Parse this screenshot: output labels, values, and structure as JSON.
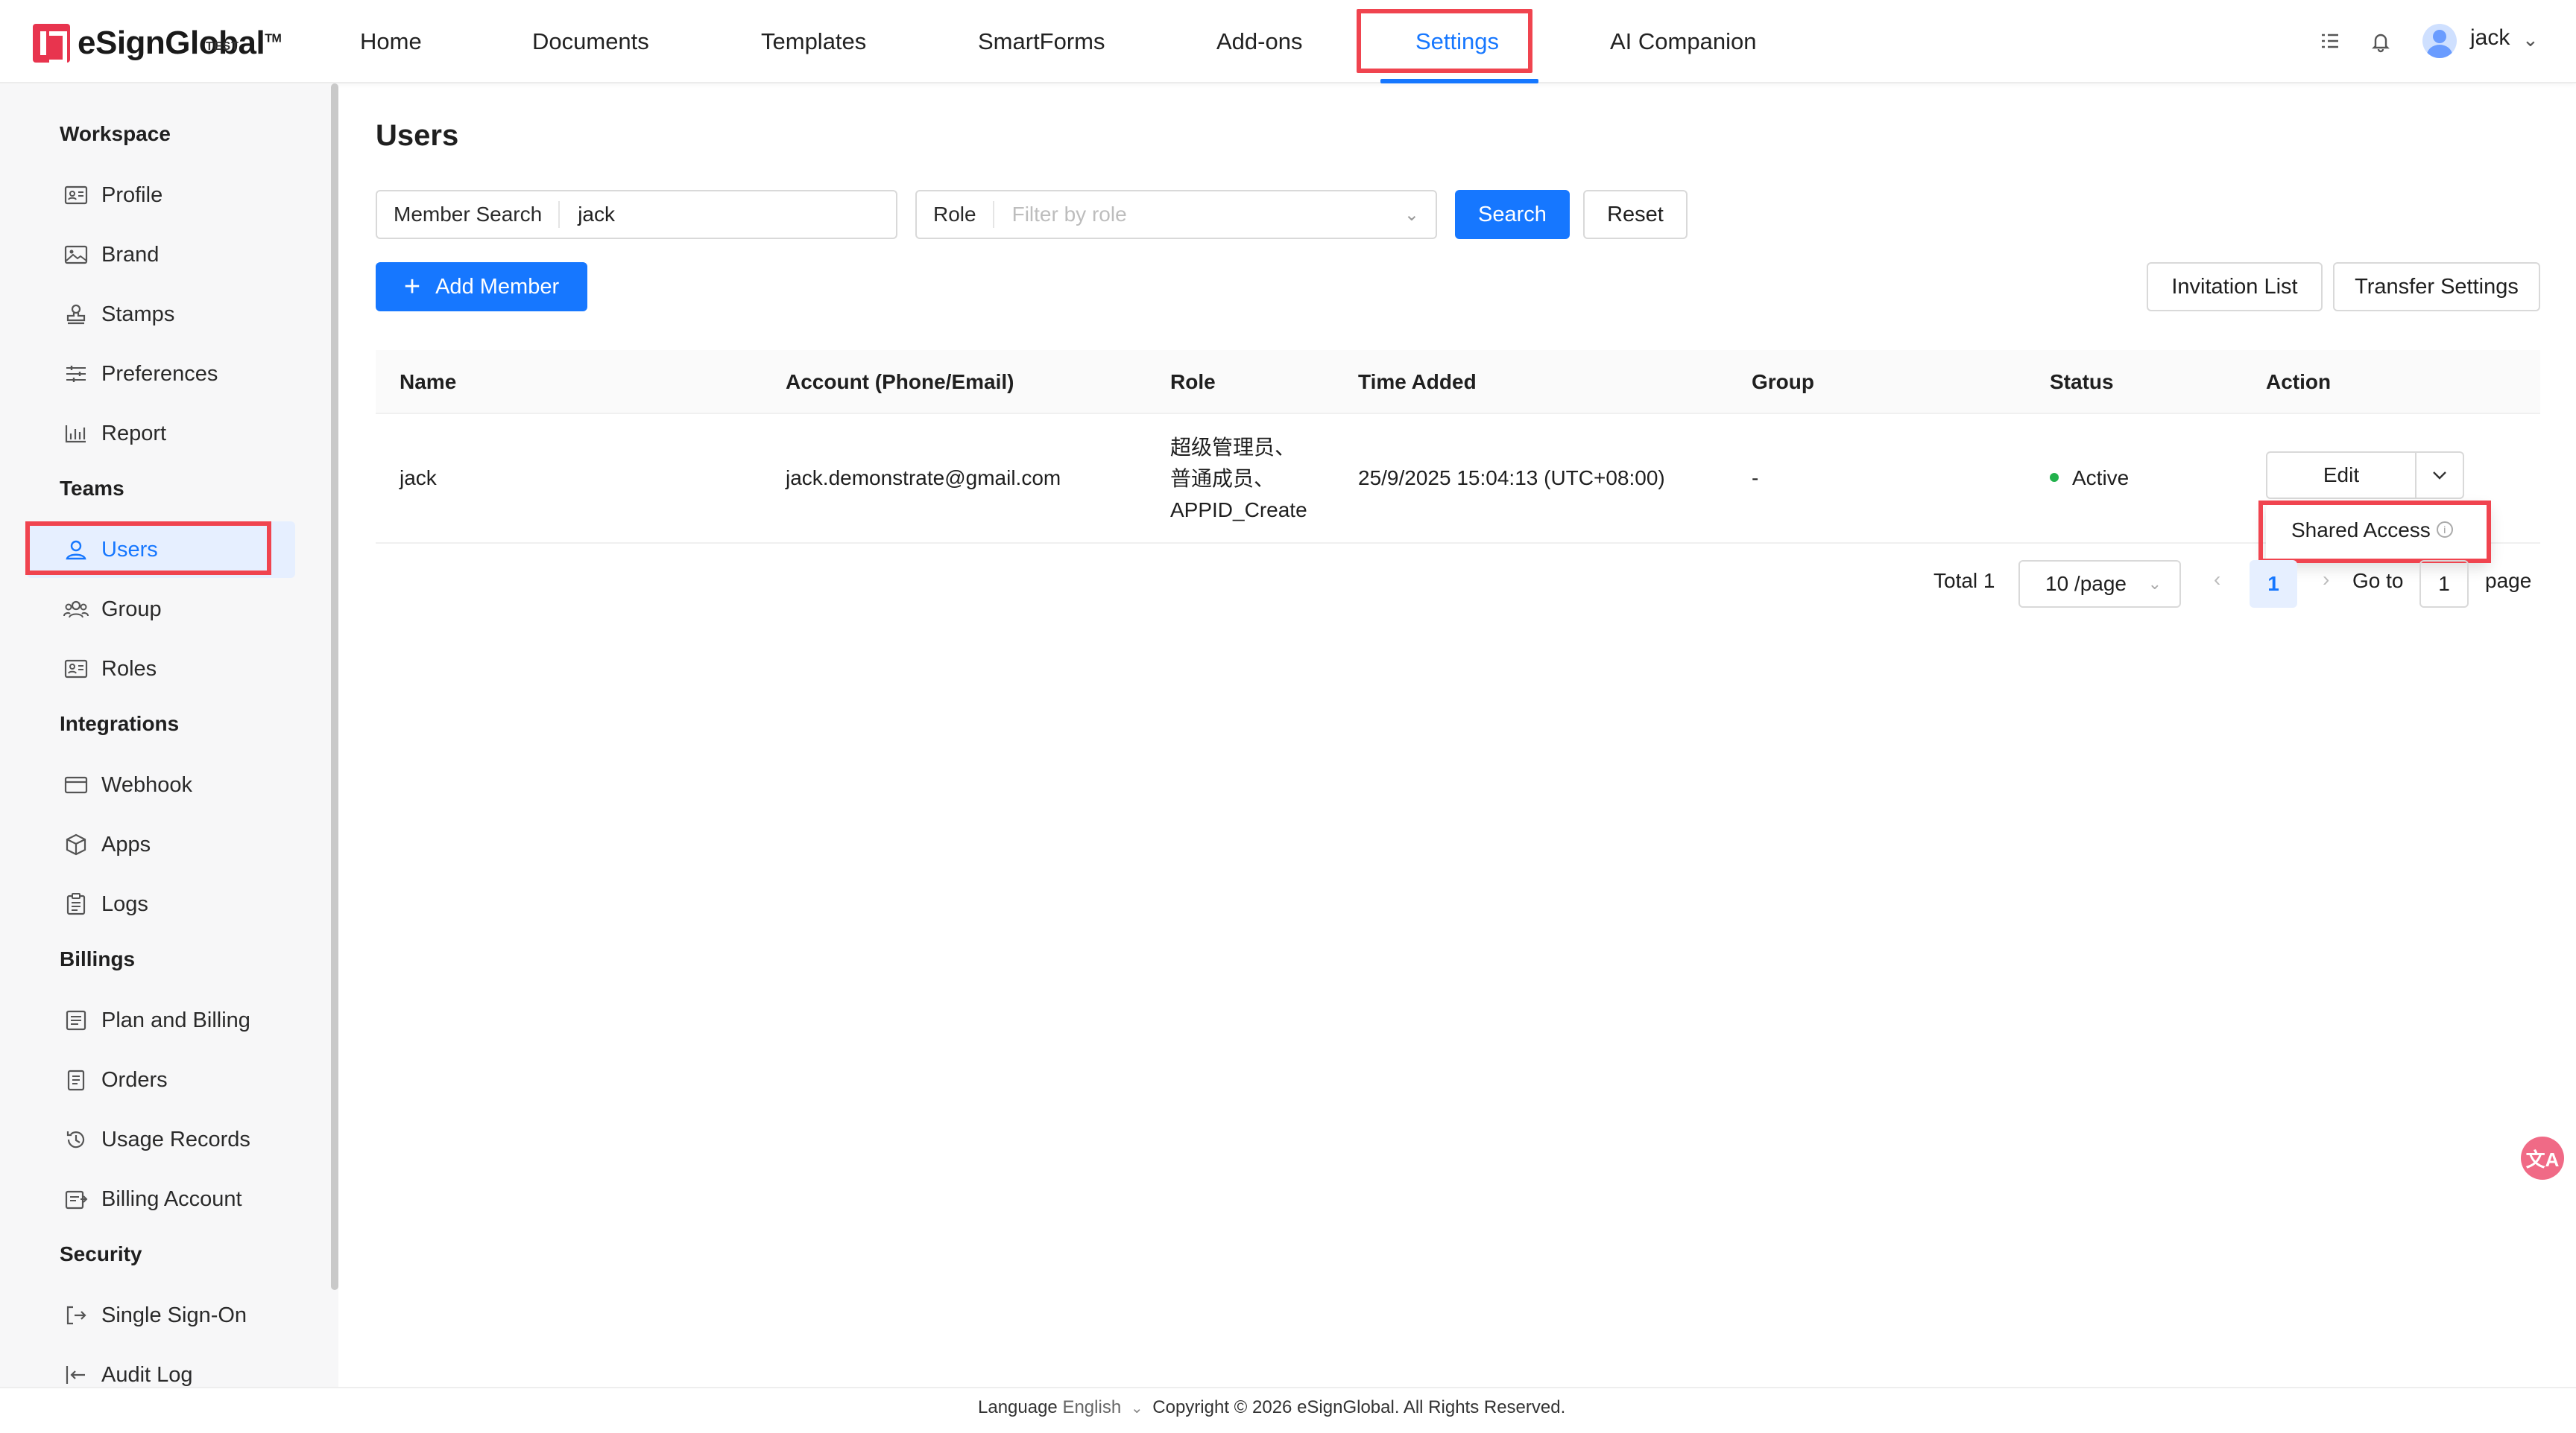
{
  "brand": {
    "name": "eSignGlobal",
    "tm": "TM",
    "env": "TEST"
  },
  "nav": {
    "items": [
      {
        "label": "Home"
      },
      {
        "label": "Documents"
      },
      {
        "label": "Templates"
      },
      {
        "label": "SmartForms"
      },
      {
        "label": "Add-ons"
      },
      {
        "label": "Settings",
        "active": true
      },
      {
        "label": "AI Companion"
      }
    ],
    "user": "jack"
  },
  "sidebar": {
    "sections": [
      {
        "title": "Workspace",
        "items": [
          {
            "label": "Profile",
            "icon": "id-card-icon"
          },
          {
            "label": "Brand",
            "icon": "image-icon"
          },
          {
            "label": "Stamps",
            "icon": "stamp-icon"
          },
          {
            "label": "Preferences",
            "icon": "sliders-icon"
          },
          {
            "label": "Report",
            "icon": "bar-chart-icon"
          }
        ]
      },
      {
        "title": "Teams",
        "items": [
          {
            "label": "Users",
            "icon": "user-icon",
            "active": true
          },
          {
            "label": "Group",
            "icon": "group-icon"
          },
          {
            "label": "Roles",
            "icon": "roles-icon"
          }
        ]
      },
      {
        "title": "Integrations",
        "items": [
          {
            "label": "Webhook",
            "icon": "webhook-icon"
          },
          {
            "label": "Apps",
            "icon": "cube-icon"
          },
          {
            "label": "Logs",
            "icon": "clipboard-icon"
          }
        ]
      },
      {
        "title": "Billings",
        "items": [
          {
            "label": "Plan and Billing",
            "icon": "plan-icon"
          },
          {
            "label": "Orders",
            "icon": "orders-icon"
          },
          {
            "label": "Usage Records",
            "icon": "history-icon"
          },
          {
            "label": "Billing Account",
            "icon": "billing-account-icon"
          }
        ]
      },
      {
        "title": "Security",
        "items": [
          {
            "label": "Single Sign-On",
            "icon": "sso-icon"
          },
          {
            "label": "Audit Log",
            "icon": "audit-log-icon"
          }
        ]
      }
    ]
  },
  "main": {
    "title": "Users",
    "filters": {
      "member_search_label": "Member Search",
      "member_search_value": "jack",
      "role_label": "Role",
      "role_placeholder": "Filter by role",
      "search_btn": "Search",
      "reset_btn": "Reset"
    },
    "actions": {
      "add_member": "Add Member",
      "invitation_list": "Invitation List",
      "transfer_settings": "Transfer Settings"
    },
    "table": {
      "columns": [
        "Name",
        "Account (Phone/Email)",
        "Role",
        "Time Added",
        "Group",
        "Status",
        "Action"
      ],
      "rows": [
        {
          "name": "jack",
          "account": "jack.demonstrate@gmail.com",
          "role_lines": [
            "超级管理员、",
            "普通成员、",
            "APPID_Create"
          ],
          "time_added": "25/9/2025 15:04:13 (UTC+08:00)",
          "group": "-",
          "status": "Active",
          "action_edit": "Edit"
        }
      ]
    },
    "dropdown": {
      "shared_access": "Shared Access"
    },
    "pagination": {
      "total": "Total 1",
      "page_size": "10 /page",
      "current_page": "1",
      "goto_label": "Go to",
      "goto_value": "1",
      "page_suffix": "page"
    }
  },
  "footer": {
    "language_label": "Language",
    "language_value": "English",
    "copyright": "Copyright © 2026 eSignGlobal. All Rights Reserved."
  },
  "colors": {
    "accent": "#1677ff",
    "highlight": "#f0444f",
    "brand": "#e8344e",
    "status_active": "#22b14c"
  }
}
